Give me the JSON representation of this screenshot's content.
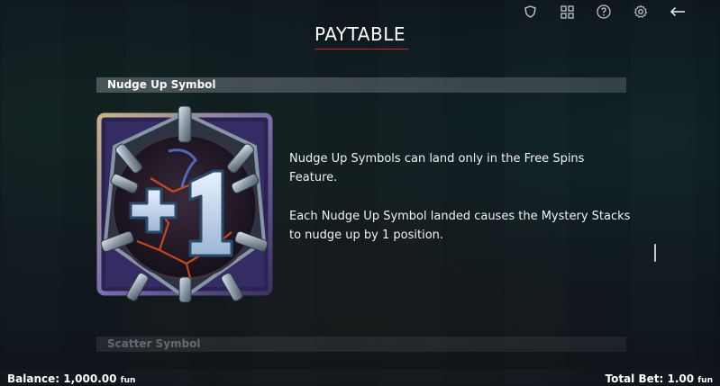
{
  "header": {
    "title": "PAYTABLE",
    "icons": [
      "shield-icon",
      "grid-icon",
      "help-icon",
      "settings-icon",
      "back-arrow-icon"
    ]
  },
  "sections": [
    {
      "title": "Nudge Up Symbol",
      "symbol": {
        "label": "+1",
        "icon": "nudge-up-symbol-icon"
      },
      "paragraphs": [
        "Nudge Up Symbols can land only in the Free Spins Feature.",
        "Each Nudge Up Symbol landed causes the Mystery Stacks to nudge up by 1 position."
      ]
    },
    {
      "title": "Scatter Symbol"
    }
  ],
  "footer": {
    "balance_label": "Balance:",
    "balance_value": "1,000.00",
    "balance_unit": "fun",
    "bet_label": "Total Bet:",
    "bet_value": "1.00",
    "bet_unit": "fun"
  },
  "colors": {
    "accent": "#c22a2a",
    "frame": "#7a6fb0",
    "orb_glow": "#e0501e"
  }
}
